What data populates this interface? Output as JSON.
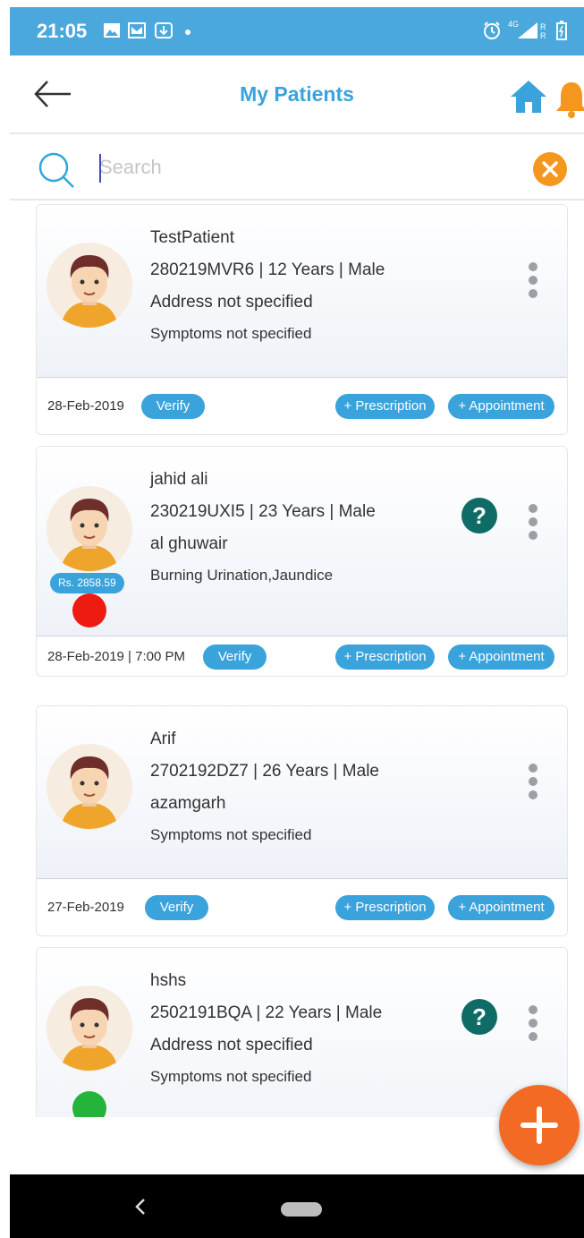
{
  "status_bar": {
    "time": "21:05",
    "network_label": "4G"
  },
  "header": {
    "title": "My Patients",
    "back_icon": "arrow-left-icon",
    "home_icon": "home-icon",
    "bell_icon": "bell-icon"
  },
  "search": {
    "placeholder": "Search",
    "value": ""
  },
  "colors": {
    "accent": "#4aa8dc",
    "button_blue": "#3aa3dc",
    "orange": "#f5961e",
    "fab": "#f26a24",
    "help_teal": "#0f6b66",
    "red": "#ee1b12",
    "green": "#24b43a"
  },
  "patients": [
    {
      "name": "TestPatient",
      "info": "280219MVR6 | 12 Years | Male",
      "address": "Address not specified",
      "symptoms": "Symptoms not specified",
      "date": "28-Feb-2019",
      "verify": "Verify",
      "prescription": "+ Prescription",
      "appointment": "+ Appointment"
    },
    {
      "name": "jahid ali",
      "info": "230219UXI5 | 23 Years | Male",
      "address": "al ghuwair",
      "symptoms": "Burning Urination,Jaundice",
      "amount": "Rs. 2858.59",
      "status": "red",
      "date": "28-Feb-2019 | 7:00 PM",
      "verify": "Verify",
      "prescription": "+ Prescription",
      "appointment": "+ Appointment"
    },
    {
      "name": "Arif",
      "info": "2702192DZ7 | 26 Years | Male",
      "address": "azamgarh",
      "symptoms": "Symptoms not specified",
      "date": "27-Feb-2019",
      "verify": "Verify",
      "prescription": "+ Prescription",
      "appointment": "+ Appointment"
    },
    {
      "name": "hshs",
      "info": "2502191BQA | 22 Years | Male",
      "address": "Address not specified",
      "symptoms": "Symptoms not specified",
      "status": "green"
    }
  ]
}
